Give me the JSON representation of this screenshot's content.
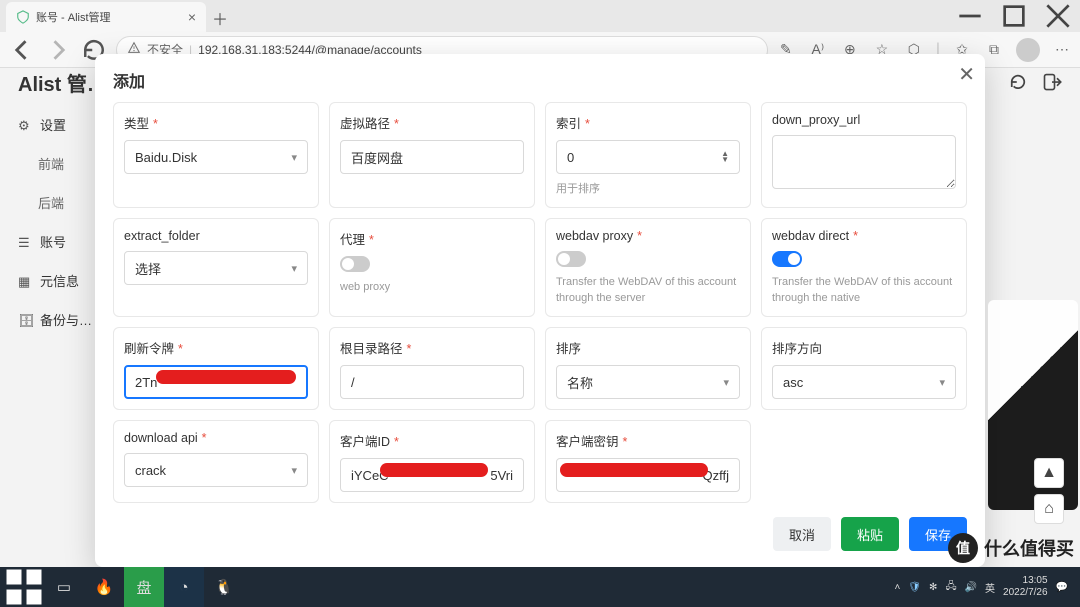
{
  "browser": {
    "tab_title": "账号 - Alist管理",
    "security_label": "不安全",
    "url": "192.168.31.183:5244/@manage/accounts"
  },
  "page": {
    "title": "Alist 管…"
  },
  "sidebar": {
    "items": [
      {
        "icon": "gear",
        "label": "设置"
      },
      {
        "icon": "none",
        "label": "前端"
      },
      {
        "icon": "none",
        "label": "后端"
      },
      {
        "icon": "list",
        "label": "账号"
      },
      {
        "icon": "grid",
        "label": "元信息"
      },
      {
        "icon": "db",
        "label": "备份与…"
      }
    ]
  },
  "modal": {
    "title": "添加",
    "actions": {
      "cancel": "取消",
      "paste": "粘贴",
      "save": "保存"
    },
    "fields": {
      "type": {
        "label": "类型",
        "required": true,
        "value": "Baidu.Disk"
      },
      "virtual_path": {
        "label": "虚拟路径",
        "required": true,
        "value": "百度网盘"
      },
      "index": {
        "label": "索引",
        "required": true,
        "value": "0",
        "hint": "用于排序"
      },
      "down_proxy_url": {
        "label": "down_proxy_url",
        "required": false,
        "value": ""
      },
      "extract_folder": {
        "label": "extract_folder",
        "required": false,
        "value": "选择"
      },
      "proxy": {
        "label": "代理",
        "required": true,
        "on": false,
        "hint": "web proxy"
      },
      "webdav_proxy": {
        "label": "webdav proxy",
        "required": true,
        "on": false,
        "hint": "Transfer the WebDAV of this account through the server"
      },
      "webdav_direct": {
        "label": "webdav direct",
        "required": true,
        "on": true,
        "hint": "Transfer the WebDAV of this account through the native"
      },
      "refresh_token": {
        "label": "刷新令牌",
        "required": true,
        "value_prefix": "2Tn",
        "value_suffix": ""
      },
      "root_folder": {
        "label": "根目录路径",
        "required": true,
        "value": "/"
      },
      "order_by": {
        "label": "排序",
        "required": false,
        "value": "名称"
      },
      "order_dir": {
        "label": "排序方向",
        "required": false,
        "value": "asc"
      },
      "download_api": {
        "label": "download api",
        "required": true,
        "value": "crack"
      },
      "client_id": {
        "label": "客户端ID",
        "required": true,
        "value_prefix": "iYCeC",
        "value_suffix": "5Vri"
      },
      "client_secret": {
        "label": "客户端密钥",
        "required": true,
        "value_prefix": "",
        "value_suffix": "Qzffj"
      }
    }
  },
  "watermark": {
    "badge": "值",
    "text": "什么值得买"
  },
  "tray": {
    "ime": "英",
    "time": "13:05",
    "date": "2022/7/26"
  }
}
